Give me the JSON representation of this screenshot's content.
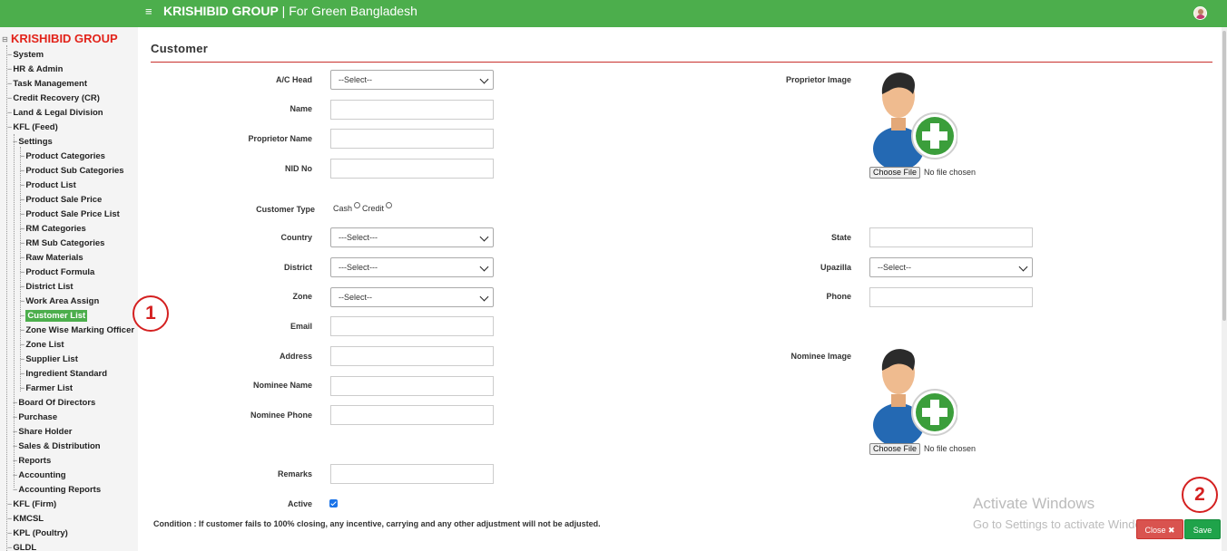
{
  "app": {
    "brand_bold": "KRISHIBID GROUP",
    "brand_rest": " | For Green Bangladesh"
  },
  "sidebar": {
    "root": "KRISHIBID GROUP",
    "items": [
      {
        "label": "System",
        "level": 1
      },
      {
        "label": "HR & Admin",
        "level": 1
      },
      {
        "label": "Task Management",
        "level": 1
      },
      {
        "label": "Credit Recovery (CR)",
        "level": 1
      },
      {
        "label": "Land & Legal Division",
        "level": 1
      },
      {
        "label": "KFL (Feed)",
        "level": 1
      },
      {
        "label": "Settings",
        "level": 2
      },
      {
        "label": "Product Categories",
        "level": 3
      },
      {
        "label": "Product Sub Categories",
        "level": 3
      },
      {
        "label": "Product List",
        "level": 3
      },
      {
        "label": "Product Sale Price",
        "level": 3
      },
      {
        "label": "Product Sale Price List",
        "level": 3
      },
      {
        "label": "RM Categories",
        "level": 3
      },
      {
        "label": "RM Sub Categories",
        "level": 3
      },
      {
        "label": "Raw Materials",
        "level": 3
      },
      {
        "label": "Product Formula",
        "level": 3
      },
      {
        "label": "District List",
        "level": 3
      },
      {
        "label": "Work Area Assign",
        "level": 3
      },
      {
        "label": "Customer List",
        "level": 3,
        "active": true
      },
      {
        "label": "Zone Wise Marking Officer",
        "level": 3
      },
      {
        "label": "Zone List",
        "level": 3
      },
      {
        "label": "Supplier List",
        "level": 3
      },
      {
        "label": "Ingredient Standard",
        "level": 3
      },
      {
        "label": "Farmer List",
        "level": 3
      },
      {
        "label": "Board Of Directors",
        "level": 2
      },
      {
        "label": "Purchase",
        "level": 2
      },
      {
        "label": "Share Holder",
        "level": 2
      },
      {
        "label": "Sales & Distribution",
        "level": 2
      },
      {
        "label": "Reports",
        "level": 2
      },
      {
        "label": "Accounting",
        "level": 2
      },
      {
        "label": "Accounting Reports",
        "level": 2
      },
      {
        "label": "KFL (Firm)",
        "level": 1
      },
      {
        "label": "KMCSL",
        "level": 1
      },
      {
        "label": "KPL (Poultry)",
        "level": 1
      },
      {
        "label": "GLDL",
        "level": 1
      }
    ]
  },
  "form": {
    "title": "Customer",
    "ac_head": {
      "label": "A/C Head",
      "value": "--Select--"
    },
    "name": {
      "label": "Name",
      "value": ""
    },
    "proprietor_name": {
      "label": "Proprietor Name",
      "value": ""
    },
    "nid_no": {
      "label": "NID No",
      "value": ""
    },
    "customer_type": {
      "label": "Customer Type",
      "options": [
        "Cash",
        "Credit"
      ]
    },
    "country": {
      "label": "Country",
      "value": "---Select---"
    },
    "district": {
      "label": "District",
      "value": "---Select---"
    },
    "zone": {
      "label": "Zone",
      "value": "--Select--"
    },
    "email": {
      "label": "Email",
      "value": ""
    },
    "address": {
      "label": "Address",
      "value": ""
    },
    "nominee_name": {
      "label": "Nominee Name",
      "value": ""
    },
    "nominee_phone": {
      "label": "Nominee Phone",
      "value": ""
    },
    "remarks": {
      "label": "Remarks",
      "value": ""
    },
    "active": {
      "label": "Active",
      "checked": true
    },
    "proprietor_image": {
      "label": "Proprietor Image",
      "button": "Choose File",
      "status": "No file chosen"
    },
    "state": {
      "label": "State",
      "value": ""
    },
    "upazilla": {
      "label": "Upazilla",
      "value": "--Select--"
    },
    "phone": {
      "label": "Phone",
      "value": ""
    },
    "nominee_image": {
      "label": "Nominee Image",
      "button": "Choose File",
      "status": "No file chosen"
    },
    "condition": "Condition : If customer fails to 100% closing, any incentive, carrying and any other adjustment will not be adjusted."
  },
  "actions": {
    "close": "Close ✖",
    "save": "Save"
  },
  "watermark": {
    "line1": "Activate Windows",
    "line2": "Go to Settings to activate Windows."
  },
  "annotations": {
    "one": "1",
    "two": "2"
  },
  "colors": {
    "topbar": "#4cae4c",
    "brand_red": "#e2231a",
    "close": "#d9534f",
    "save": "#1fa34a",
    "annotation": "#d42020"
  }
}
